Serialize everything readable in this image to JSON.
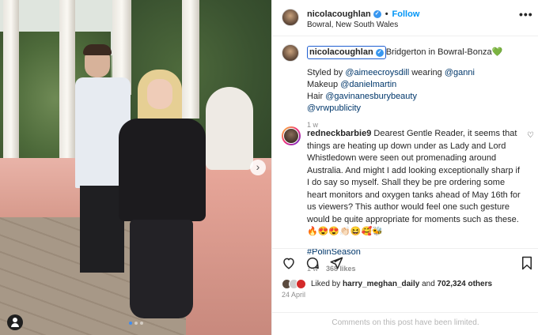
{
  "header": {
    "username": "nicolacoughlan",
    "follow_label": "Follow",
    "location": "Bowral, New South Wales",
    "separator": "•",
    "more_label": "•••"
  },
  "caption": {
    "username": "nicolacoughlan",
    "text": "Bridgerton in Bowral-Bonza",
    "emoji": "💚",
    "line1_prefix": "Styled by ",
    "line1_mention1": "@aimeecroysdill",
    "line1_mid": " wearing ",
    "line1_mention2": "@ganni",
    "line2_prefix": "Makeup ",
    "line2_mention": "@danielmartin",
    "line3_prefix": "Hair ",
    "line3_mention": "@gavinanesburybeauty",
    "line4_mention": "@vrwpublicity",
    "time": "1 w"
  },
  "comment": {
    "username": "redneckbarbie9",
    "text": "Dearest Gentle Reader, it seems that things are heating up down under as Lady and Lord Whistledown were seen out promenading around Australia. And might I add looking exceptionally sharp if I do say so myself. Shall they be pre ordering some heart monitors and oxygen tanks ahead of May 16th for us viewers? This author would feel one such gesture would be quite appropriate for moments such as these.🔥😍😍👏🏻😆🥰🐝",
    "hashtag": "#PolinSeason",
    "time": "1 w",
    "likes": "368 likes"
  },
  "likes": {
    "prefix": "Liked by ",
    "user": "harry_meghan_daily",
    "and": " and ",
    "count": "702,324 others"
  },
  "date": "24 April",
  "comments_limited": "Comments on this post have been limited.",
  "icons": {
    "like": "heart-icon",
    "comment": "comment-icon",
    "share": "share-icon",
    "save": "bookmark-icon",
    "next": "chevron-right-icon"
  },
  "colors": {
    "link": "#0095f6",
    "mention": "#00376b",
    "verified": "#3897f0",
    "muted": "#8e8e8e"
  }
}
